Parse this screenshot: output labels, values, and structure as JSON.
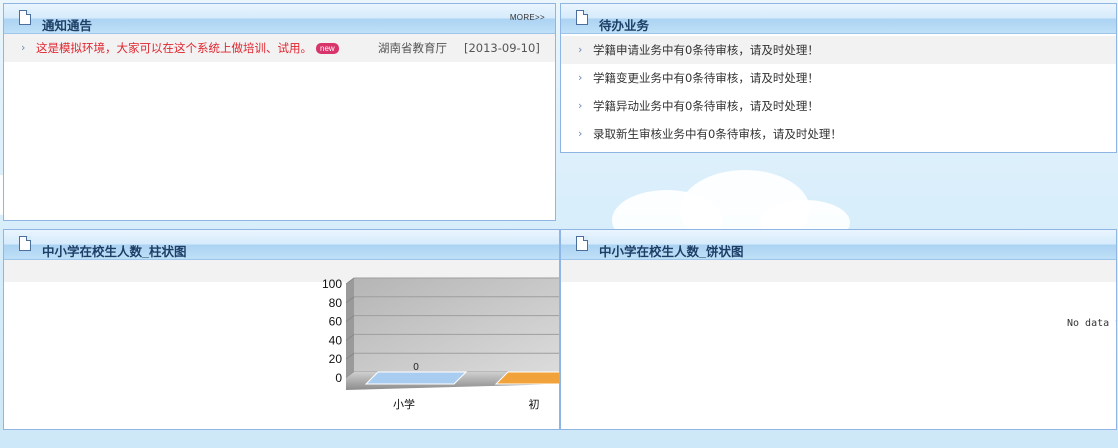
{
  "notice_panel": {
    "title": "通知通告",
    "more_label": "MORE>>",
    "items": [
      {
        "text": "这是模拟环境，大家可以在这个系统上做培训、试用。",
        "badge": "new",
        "source": "湖南省教育厅",
        "date": "[2013-09-10]"
      }
    ]
  },
  "todo_panel": {
    "title": "待办业务",
    "items": [
      {
        "text": "学籍申请业务中有0条待审核，请及时处理！"
      },
      {
        "text": "学籍变更业务中有0条待审核，请及时处理！"
      },
      {
        "text": "学籍异动业务中有0条待审核，请及时处理！"
      },
      {
        "text": "录取新生审核业务中有0条待审核，请及时处理！"
      }
    ]
  },
  "bar_panel": {
    "title": "中小学在校生人数_柱状图"
  },
  "pie_panel": {
    "title": "中小学在校生人数_饼状图",
    "no_data_text": "No data t"
  },
  "chart_data": {
    "type": "bar",
    "categories": [
      "小学",
      "初"
    ],
    "values": [
      0,
      0
    ],
    "data_labels": [
      "0"
    ],
    "ylim": [
      0,
      100
    ],
    "yticks": [
      "100",
      "80",
      "60",
      "40",
      "20",
      "0"
    ],
    "bar_colors": [
      "#a9cdf0",
      "#f2a23a"
    ]
  }
}
